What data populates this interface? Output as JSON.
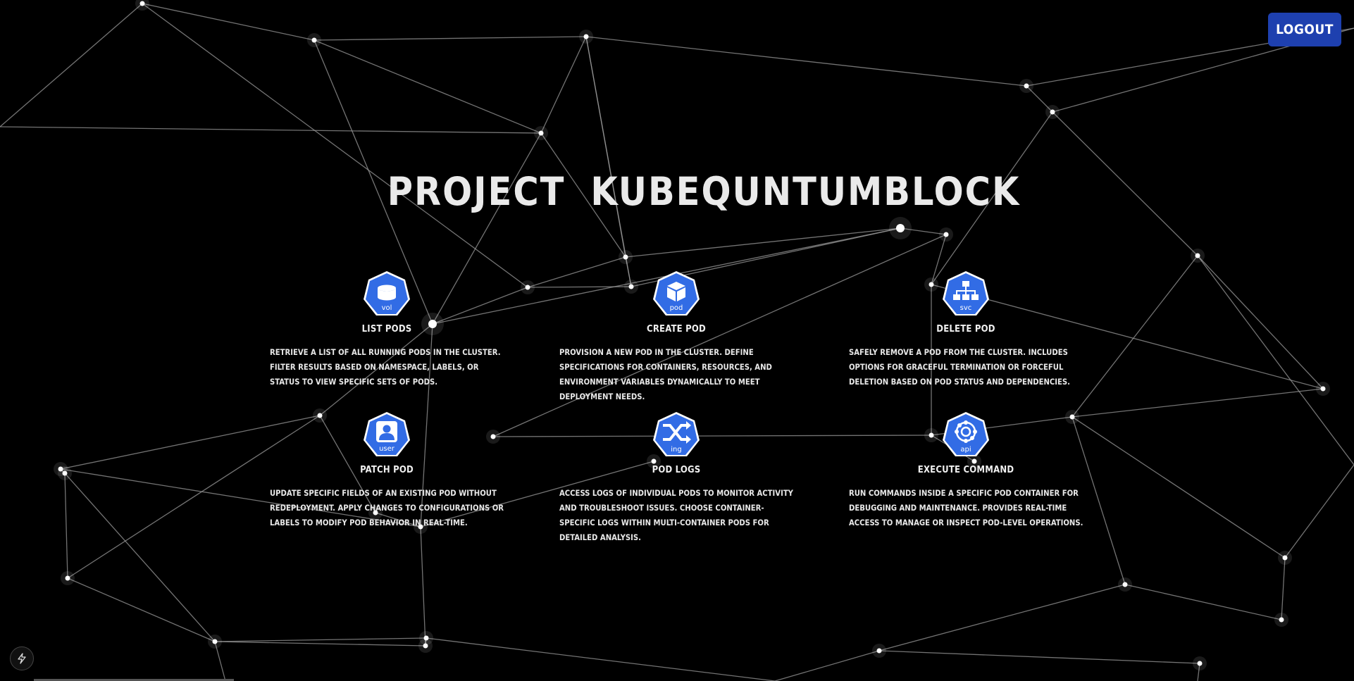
{
  "header": {
    "logout_label": "LOGOUT"
  },
  "title": {
    "word1": "PROJECT",
    "word2": "KUBEQUNTUMBLOCK"
  },
  "cards": [
    {
      "icon": "vol-icon",
      "icon_text": "vol",
      "title": "LIST PODS",
      "description": "Retrieve a list of all running pods in the cluster. Filter results based on namespace, labels, or status to view specific sets of pods."
    },
    {
      "icon": "pod-icon",
      "icon_text": "pod",
      "title": "CREATE POD",
      "description": "Provision a new pod in the cluster. Define specifications for containers, resources, and environment variables dynamically to meet deployment needs."
    },
    {
      "icon": "svc-icon",
      "icon_text": "svc",
      "title": "DELETE POD",
      "description": "Safely remove a pod from the cluster. Includes options for graceful termination or forceful deletion based on pod status and dependencies."
    },
    {
      "icon": "user-icon",
      "icon_text": "user",
      "title": "PATCH POD",
      "description": "Update specific fields of an existing pod without redeployment. Apply changes to configurations or labels to modify pod behavior in real-time."
    },
    {
      "icon": "ing-icon",
      "icon_text": "ing",
      "title": "POD LOGS",
      "description": "Access logs of individual pods to monitor activity and troubleshoot issues. Choose container-specific logs within multi-container pods for detailed analysis."
    },
    {
      "icon": "api-icon",
      "icon_text": "api",
      "title": "EXECUTE COMMAND",
      "description": "Run commands inside a specific pod container for debugging and maintenance. Provides real-time access to manage or inspect pod-level operations."
    }
  ],
  "colors": {
    "accent": "#1e40af",
    "icon_blue": "#326ce5",
    "background": "#000000"
  }
}
